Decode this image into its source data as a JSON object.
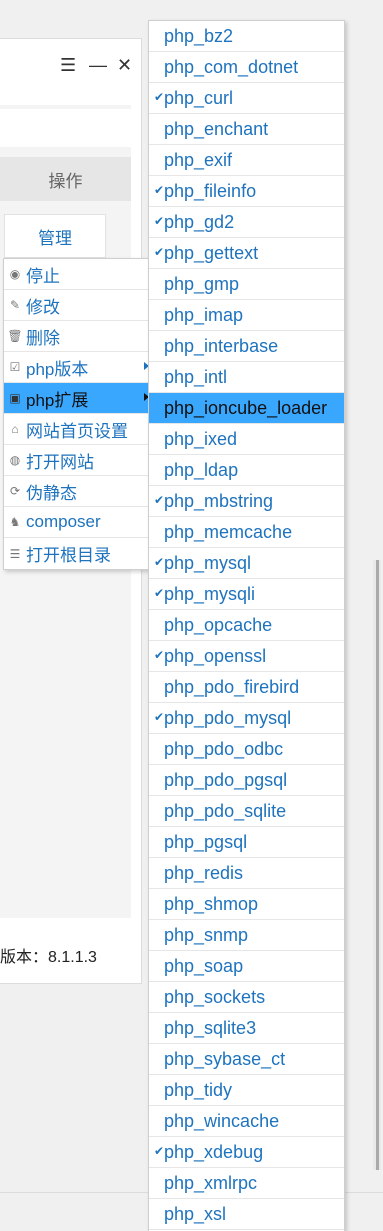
{
  "window": {
    "controls": {
      "menu": "☰",
      "minimize": "—",
      "close": "✕"
    },
    "ops_header": "操作",
    "manage_button": "管理",
    "version_text": "版本：8.1.1.3"
  },
  "site_menu": {
    "items": [
      {
        "label": "停止",
        "icon": "stop-icon",
        "glyph": "◉",
        "submenu": false,
        "active": false
      },
      {
        "label": "修改",
        "icon": "edit-icon",
        "glyph": "✎",
        "submenu": false,
        "active": false
      },
      {
        "label": "删除",
        "icon": "trash-icon",
        "glyph": "🗑",
        "submenu": false,
        "active": false
      },
      {
        "label": "php版本",
        "icon": "php-version-icon",
        "glyph": "☑",
        "submenu": true,
        "active": false
      },
      {
        "label": "php扩展",
        "icon": "php-extension-icon",
        "glyph": "▣",
        "submenu": true,
        "active": true
      },
      {
        "label": "网站首页设置",
        "icon": "home-icon",
        "glyph": "⌂",
        "submenu": false,
        "active": false
      },
      {
        "label": "打开网站",
        "icon": "globe-icon",
        "glyph": "◍",
        "submenu": false,
        "active": false
      },
      {
        "label": "伪静态",
        "icon": "rewrite-icon",
        "glyph": "⟳",
        "submenu": false,
        "active": false
      },
      {
        "label": "composer",
        "icon": "composer-icon",
        "glyph": "♞",
        "submenu": false,
        "active": false
      },
      {
        "label": "打开根目录",
        "icon": "folder-list-icon",
        "glyph": "☰",
        "submenu": false,
        "active": false
      }
    ]
  },
  "extensions_menu": {
    "check_glyph": "✔",
    "items": [
      {
        "label": "php_bz2",
        "checked": false,
        "active": false
      },
      {
        "label": "php_com_dotnet",
        "checked": false,
        "active": false
      },
      {
        "label": "php_curl",
        "checked": true,
        "active": false
      },
      {
        "label": "php_enchant",
        "checked": false,
        "active": false
      },
      {
        "label": "php_exif",
        "checked": false,
        "active": false
      },
      {
        "label": "php_fileinfo",
        "checked": true,
        "active": false
      },
      {
        "label": "php_gd2",
        "checked": true,
        "active": false
      },
      {
        "label": "php_gettext",
        "checked": true,
        "active": false
      },
      {
        "label": "php_gmp",
        "checked": false,
        "active": false
      },
      {
        "label": "php_imap",
        "checked": false,
        "active": false
      },
      {
        "label": "php_interbase",
        "checked": false,
        "active": false
      },
      {
        "label": "php_intl",
        "checked": false,
        "active": false
      },
      {
        "label": "php_ioncube_loader",
        "checked": false,
        "active": true
      },
      {
        "label": "php_ixed",
        "checked": false,
        "active": false
      },
      {
        "label": "php_ldap",
        "checked": false,
        "active": false
      },
      {
        "label": "php_mbstring",
        "checked": true,
        "active": false
      },
      {
        "label": "php_memcache",
        "checked": false,
        "active": false
      },
      {
        "label": "php_mysql",
        "checked": true,
        "active": false
      },
      {
        "label": "php_mysqli",
        "checked": true,
        "active": false
      },
      {
        "label": "php_opcache",
        "checked": false,
        "active": false
      },
      {
        "label": "php_openssl",
        "checked": true,
        "active": false
      },
      {
        "label": "php_pdo_firebird",
        "checked": false,
        "active": false
      },
      {
        "label": "php_pdo_mysql",
        "checked": true,
        "active": false
      },
      {
        "label": "php_pdo_odbc",
        "checked": false,
        "active": false
      },
      {
        "label": "php_pdo_pgsql",
        "checked": false,
        "active": false
      },
      {
        "label": "php_pdo_sqlite",
        "checked": false,
        "active": false
      },
      {
        "label": "php_pgsql",
        "checked": false,
        "active": false
      },
      {
        "label": "php_redis",
        "checked": false,
        "active": false
      },
      {
        "label": "php_shmop",
        "checked": false,
        "active": false
      },
      {
        "label": "php_snmp",
        "checked": false,
        "active": false
      },
      {
        "label": "php_soap",
        "checked": false,
        "active": false
      },
      {
        "label": "php_sockets",
        "checked": false,
        "active": false
      },
      {
        "label": "php_sqlite3",
        "checked": false,
        "active": false
      },
      {
        "label": "php_sybase_ct",
        "checked": false,
        "active": false
      },
      {
        "label": "php_tidy",
        "checked": false,
        "active": false
      },
      {
        "label": "php_wincache",
        "checked": false,
        "active": false
      },
      {
        "label": "php_xdebug",
        "checked": true,
        "active": false
      },
      {
        "label": "php_xmlrpc",
        "checked": false,
        "active": false
      },
      {
        "label": "php_xsl",
        "checked": false,
        "active": false
      }
    ]
  },
  "colors": {
    "link": "#1e73be",
    "highlight": "#3aa7ff"
  }
}
